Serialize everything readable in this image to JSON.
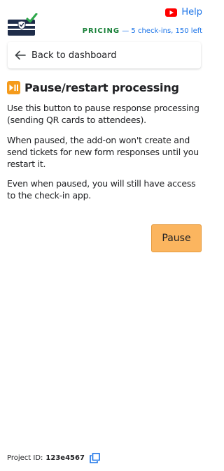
{
  "header": {
    "help_label": "Help",
    "pricing_label": "PRICING",
    "pricing_separator": "—",
    "pricing_detail": "5 check-ins, 150 left",
    "logo_icon": "ticket-check-logo-icon",
    "help_icon": "youtube-play-icon"
  },
  "nav": {
    "back_label": "Back to dashboard",
    "back_icon": "arrow-left-icon"
  },
  "section": {
    "title": "Pause/restart processing",
    "title_icon": "play-pause-emoji-icon",
    "paragraphs": [
      "Use this button to pause response processing (sending QR cards to attendees).",
      "When paused, the add-on won't create and send tickets for new form responses until you restart it.",
      "Even when paused, you will still have access to the check-in app."
    ],
    "pause_label": "Pause"
  },
  "footer": {
    "project_label": "Project ID:",
    "project_value": "123e4567",
    "copy_icon": "copy-icon"
  },
  "colors": {
    "accent_blue": "#1a73e8",
    "pricing_green": "#188038",
    "pause_button": "#fbb55f",
    "youtube_red": "#ff0000",
    "emoji_orange": "#f59b1c",
    "logo_navy": "#1f2d4a",
    "logo_check_green": "#2ca84a"
  }
}
